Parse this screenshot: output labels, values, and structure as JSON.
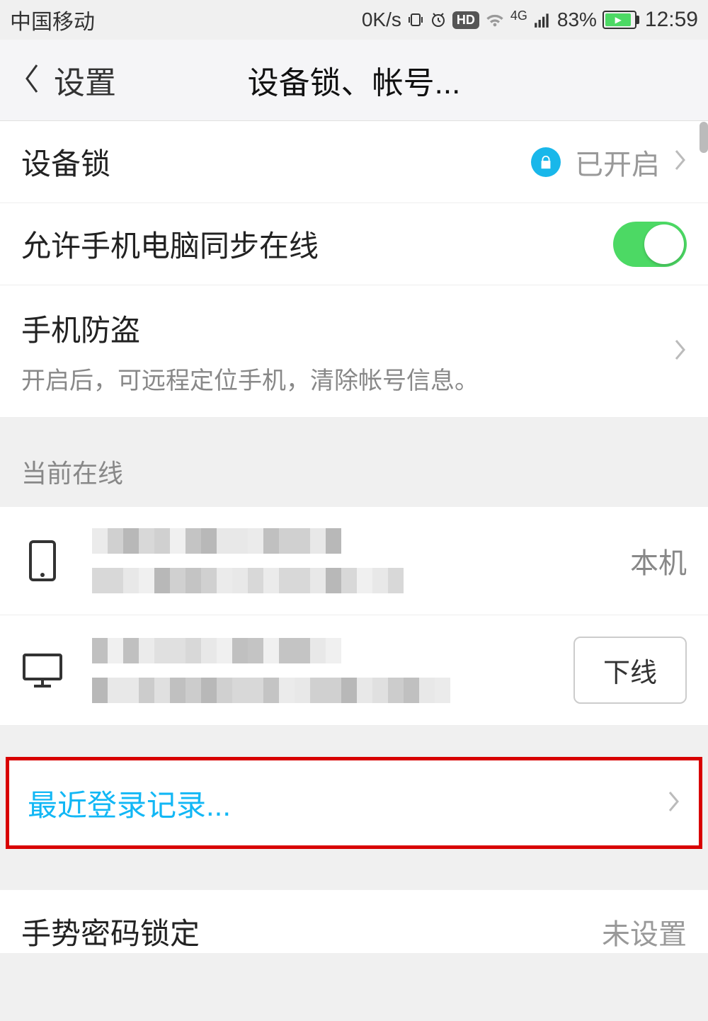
{
  "status_bar": {
    "carrier": "中国移动",
    "speed": "0K/s",
    "hd_label": "HD",
    "network_label": "4G",
    "battery_percent": "83%",
    "time": "12:59"
  },
  "nav": {
    "back_label": "设置",
    "title": "设备锁、帐号..."
  },
  "items": {
    "device_lock": {
      "title": "设备锁",
      "status": "已开启"
    },
    "sync_online": {
      "title": "允许手机电脑同步在线"
    },
    "anti_theft": {
      "title": "手机防盗",
      "subtitle": "开启后，可远程定位手机，清除帐号信息。"
    }
  },
  "online_section": {
    "header": "当前在线",
    "devices": [
      {
        "type": "phone",
        "trail": "本机"
      },
      {
        "type": "desktop",
        "action_label": "下线"
      }
    ]
  },
  "recent_login": {
    "title": "最近登录记录..."
  },
  "gesture_lock": {
    "title": "手势密码锁定",
    "status": "未设置"
  },
  "pixelated_shades": [
    "#d0d0d0",
    "#e8e8e8",
    "#c0c0c0",
    "#f0f0f0",
    "#d8d8d8",
    "#b8b8b8",
    "#e0e0e0",
    "#cccccc",
    "#ebebeb",
    "#c4c4c4"
  ]
}
